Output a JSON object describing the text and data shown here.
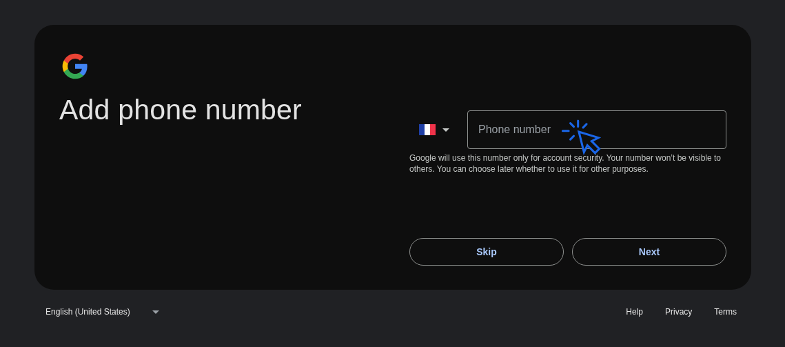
{
  "card": {
    "title": "Add phone number",
    "phone_field": {
      "placeholder": "Phone number"
    },
    "helper_text": "Google will use this number only for account security. Your number won’t be visible to others. You can choose later whether to use it for other purposes.",
    "buttons": [
      {
        "label": "Skip"
      },
      {
        "label": "Next"
      }
    ]
  },
  "footer": {
    "language": "English (United States)",
    "links": [
      {
        "label": "Help"
      },
      {
        "label": "Privacy"
      },
      {
        "label": "Terms"
      }
    ]
  }
}
